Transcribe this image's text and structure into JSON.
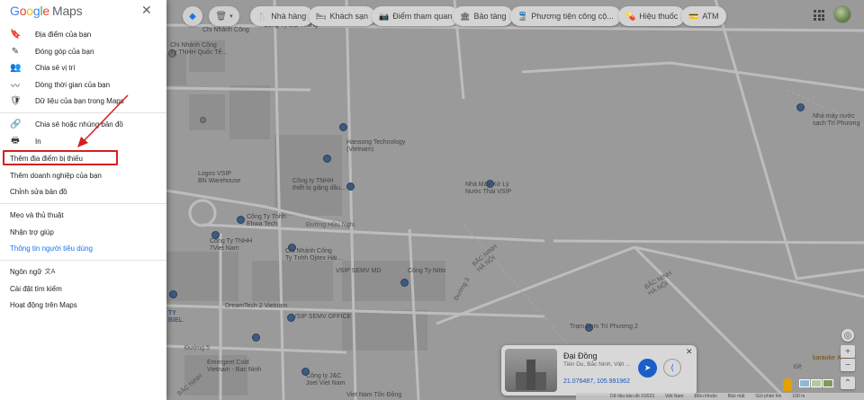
{
  "sidebar": {
    "logo": {
      "google": [
        "G",
        "o",
        "o",
        "g",
        "l",
        "e"
      ],
      "maps": "Maps"
    },
    "group1": [
      {
        "icon": "bookmark-icon",
        "glyph": "🔖",
        "label": "Địa điểm của bạn"
      },
      {
        "icon": "contribute-icon",
        "glyph": "✎",
        "label": "Đóng góp của bạn"
      },
      {
        "icon": "share-location-icon",
        "glyph": "👥",
        "label": "Chia sẻ vị trí"
      },
      {
        "icon": "timeline-icon",
        "glyph": "〰",
        "label": "Dòng thời gian của bạn"
      },
      {
        "icon": "data-shield-icon",
        "glyph": "🛡",
        "label": "Dữ liệu của bạn trong Maps"
      }
    ],
    "group2": [
      {
        "icon": "link-icon",
        "glyph": "🔗",
        "label": "Chia sẻ hoặc nhúng bản đồ"
      },
      {
        "icon": "print-icon",
        "glyph": "🖶",
        "label": "In"
      }
    ],
    "group3": [
      "Thêm địa điểm bị thiếu",
      "Thêm doanh nghiệp của bạn",
      "Chỉnh sửa bản đồ"
    ],
    "group4": [
      "Mẹo và thủ thuật",
      "Nhận trợ giúp",
      "Thông tin người tiêu dùng"
    ],
    "group5": [
      "Ngôn ngữ",
      "Cài đặt tìm kiếm",
      "Hoạt động trên Maps"
    ],
    "language_glyph": "文A"
  },
  "chips": [
    {
      "icon": "restaurant-icon",
      "glyph": "🍴",
      "label": "Nhà hàng"
    },
    {
      "icon": "hotel-icon",
      "glyph": "🛏",
      "label": "Khách sạn"
    },
    {
      "icon": "attraction-icon",
      "glyph": "📷",
      "label": "Điểm tham quan"
    },
    {
      "icon": "museum-icon",
      "glyph": "🏛",
      "label": "Bảo tàng"
    },
    {
      "icon": "transit-icon",
      "glyph": "🚆",
      "label": "Phương tiện công cộ..."
    },
    {
      "icon": "pharmacy-icon",
      "glyph": "💊",
      "label": "Hiệu thuốc"
    },
    {
      "icon": "atm-icon",
      "glyph": "💳",
      "label": "ATM"
    }
  ],
  "map_labels": [
    "Chi Nhánh Công\nTy TNHH Quốc Tế...",
    "Hansong Technology\n(Vietnam)",
    "Công ty TNHH\nthiết bị giặng dầu...",
    "Logos VSIP\nBN Warehouse",
    "Nhà Máy Xử Lý\nNước Thải VSIP",
    "Nhà máy nước\nsạch Trí Phương",
    "Công Ty Tnhh\nEhwa Tech",
    "Công Ty TNHH\n7Viet Nam",
    "Chi Nhánh Công\nTy Tnhh Ojitex Hải...",
    "VSIP SEMV MD",
    "Công Ty Nitto",
    "DreamTech 2 Vietnam",
    "VSIP SEMV OFFICE",
    "Emergent Cold\nVietnam - Bac Ninh",
    "Trạm bơm Trí Phương 2",
    "Công ty J&C\nJoel Viet Nam",
    "Đường Hữu Nghị",
    "BẮC NINH\nHÀ NỘI",
    "BẮC NINH\nHÀ NỘI",
    "Đường 5",
    "Đường 3",
    "karaoke Xuân",
    "Đê",
    "BẮC NINH",
    "TY\nBIEL",
    "Chi Nhánh Công",
    "Công Ty Đại Thắng",
    "Viet Nam Tôn Đồng"
  ],
  "card": {
    "title": "Đại Đồng",
    "subtitle": "Tiên Du, Bắc Ninh, Việt ...",
    "coordinates": "21.076487, 105.991962",
    "close": "✕",
    "directions_glyph": "➤",
    "share_glyph": "⟨"
  },
  "controls": {
    "zoom_in": "+",
    "zoom_out": "−",
    "locate": "◎",
    "expand": "⌃"
  },
  "footer": {
    "copyright": "Dữ liệu bản đồ ©2023",
    "items": [
      "Dữ liệu bản đồ ©2023",
      "Việt Nam",
      "Điều khoản",
      "Bảo mật",
      "Gửi phản hồi",
      "100 m"
    ]
  },
  "colors": {
    "sidebar_bg": "#ffffff",
    "map_bg": "#9a9a9a",
    "highlight": "#d32020",
    "accent": "#1a73e8"
  }
}
